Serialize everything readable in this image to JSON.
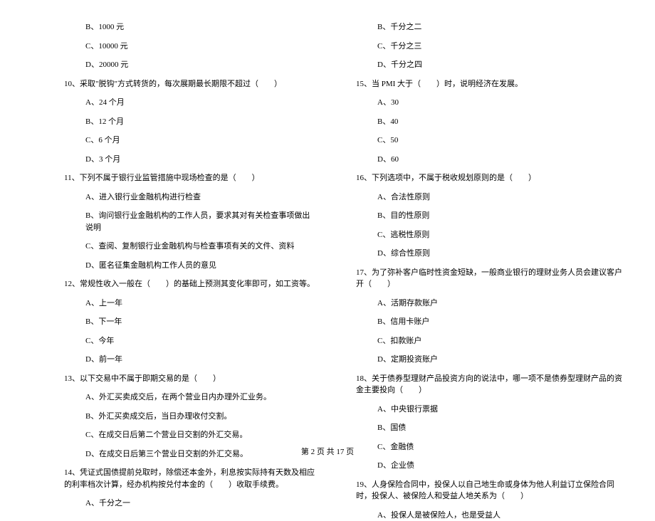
{
  "left": {
    "q9_options": [
      "B、1000 元",
      "C、10000 元",
      "D、20000 元"
    ],
    "q10": {
      "stem": "10、采取\"脱钩\"方式转货的，每次展期最长期限不超过（　　）",
      "options": [
        "A、24 个月",
        "B、12 个月",
        "C、6 个月",
        "D、3 个月"
      ]
    },
    "q11": {
      "stem": "11、下列不属于银行业监管措施中现场检查的是（　　）",
      "options": [
        "A、进入银行业金融机构进行检查",
        "B、询问银行业金融机构的工作人员，要求其对有关检查事项做出说明",
        "C、查阅、复制银行业金融机构与检查事项有关的文件、资料",
        "D、匿名征集金融机构工作人员的意见"
      ]
    },
    "q12": {
      "stem": "12、常规性收入一般在（　　）的基础上预测其变化率即可，如工资等。",
      "options": [
        "A、上一年",
        "B、下一年",
        "C、今年",
        "D、前一年"
      ]
    },
    "q13": {
      "stem": "13、以下交易中不属于即期交易的是（　　）",
      "options": [
        "A、外汇买卖成交后，在两个营业日内办理外汇业务。",
        "B、外汇买卖成交后，当日办理收付交割。",
        "C、在成交日后第二个营业日交割的外汇交易。",
        "D、在成交日后第三个营业日交割的外汇交易。"
      ]
    },
    "q14": {
      "stem": "14、凭证式国债提前兑取时，除偿还本金外，利息按实际持有天数及相应的利率档次计算，经办机构按兑付本金的（　　）收取手续费。",
      "options": [
        "A、千分之一"
      ]
    }
  },
  "right": {
    "q14_options_cont": [
      "B、千分之二",
      "C、千分之三",
      "D、千分之四"
    ],
    "q15": {
      "stem": "15、当 PMI 大于（　　）时，说明经济在发展。",
      "options": [
        "A、30",
        "B、40",
        "C、50",
        "D、60"
      ]
    },
    "q16": {
      "stem": "16、下列选项中，不属于税收规划原则的是（　　）",
      "options": [
        "A、合法性原则",
        "B、目的性原则",
        "C、逃税性原则",
        "D、综合性原则"
      ]
    },
    "q17": {
      "stem": "17、为了弥补客户临时性资金短缺，一般商业银行的理财业务人员会建议客户开（　　）",
      "options": [
        "A、活期存款账户",
        "B、信用卡账户",
        "C、扣款账户",
        "D、定期投资账户"
      ]
    },
    "q18": {
      "stem": "18、关于债券型理财产品投资方向的说法中，哪一项不是债券型理财产品的资金主要投向（　　）",
      "options": [
        "A、中央银行票据",
        "B、国债",
        "C、金融债",
        "D、企业债"
      ]
    },
    "q19": {
      "stem": "19、人身保险合同中，投保人以自己地生命或身体为他人利益订立保险合同时，投保人、被保险人和受益人地关系为（　　）",
      "options": [
        "A、投保人是被保险人，也是受益人"
      ]
    }
  },
  "footer": "第 2 页 共 17 页"
}
